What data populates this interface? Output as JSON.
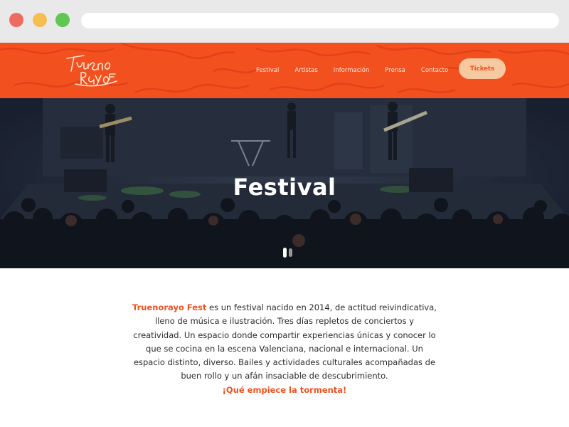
{
  "site": {
    "logo_text": "Trueno Rayo Fest",
    "logo_line1": "Trueno",
    "logo_line2": "Rayo",
    "logo_line3": "FEST"
  },
  "nav": {
    "items": [
      {
        "label": "Festival"
      },
      {
        "label": "Artistas"
      },
      {
        "label": "Información"
      },
      {
        "label": "Prensa"
      },
      {
        "label": "Contacto"
      }
    ],
    "tickets_label": "Tickets"
  },
  "hero": {
    "title": "Festival",
    "slides_total": 2,
    "active_slide": 1
  },
  "intro": {
    "brand": "Truenorayo Fest",
    "body": " es un festival nacido en 2014, de actitud reivindicativa, lleno de música e ilustración. Tres días repletos de conciertos y creatividad. Un espacio donde compartir experiencias únicas y conocer lo que se cocina en la escena Valenciana, nacional e internacional. Un espacio distinto, diverso. Bailes y actividades culturales acompañadas de buen rollo y un afán insaciable de descubrimiento.",
    "cta": "¡Qué empiece la tormenta!"
  },
  "colors": {
    "brand_orange": "#f3501f",
    "tickets_bg": "#f6c9a0",
    "chrome_bg": "#e9e9ea"
  }
}
